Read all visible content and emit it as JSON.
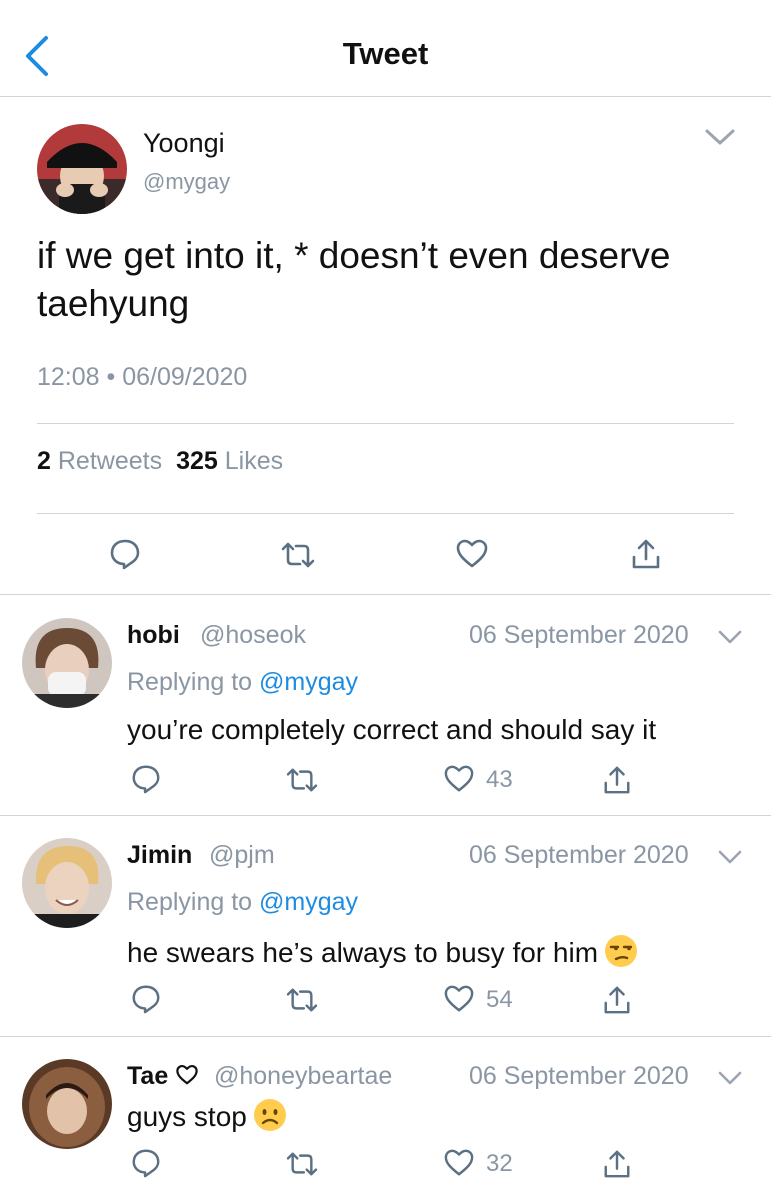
{
  "header": {
    "title": "Tweet"
  },
  "tweet": {
    "name": "Yoongi",
    "handle": "@mygay",
    "text": "if we get into it, * doesn’t even deserve taehyung",
    "timestamp": "12:08 • 06/09/2020",
    "retweets_count": "2",
    "retweets_label": "Retweets",
    "likes_count": "325",
    "likes_label": "Likes"
  },
  "replying_label": "Replying to",
  "replies": [
    {
      "name": "hobi",
      "handle": "@hoseok",
      "date": "06 September 2020",
      "replying_to": "@mygay",
      "text": "you’re completely correct and should say it",
      "likes": "43"
    },
    {
      "name": "Jimin",
      "handle": "@pjm",
      "date": "06 September 2020",
      "replying_to": "@mygay",
      "text": "he swears he’s always to busy for him",
      "emoji": "unamused-face",
      "likes": "54"
    },
    {
      "name": "Tae",
      "name_icon": "heart-outline-icon",
      "handle": "@honeybeartae",
      "date": "06 September 2020",
      "text": "guys stop",
      "emoji": "frowning-face",
      "likes": "32"
    }
  ],
  "colors": {
    "accent": "#1d8ce0",
    "muted": "#8a96a3",
    "divider": "#cfd5da",
    "icon": "#5b7083"
  }
}
